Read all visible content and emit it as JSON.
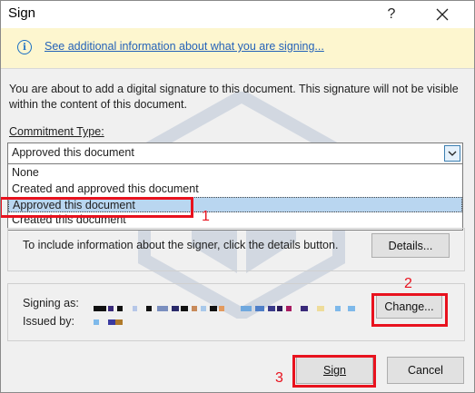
{
  "dialog": {
    "title": "Sign",
    "help_label": "?",
    "close_label": "✕"
  },
  "infobar": {
    "icon": "info-icon",
    "link_text": "See additional information about what you are signing..."
  },
  "description": "You are about to add a digital signature to this document. This signature will not be visible within the content of this document.",
  "commitment": {
    "label": "Commitment Type:",
    "selected": "Approved this document",
    "options": [
      "None",
      "Created and approved this document",
      "Approved this document",
      "Created this document"
    ]
  },
  "details": {
    "text": "To include information about the signer, click the details button.",
    "button_label": "Details..."
  },
  "signing": {
    "signing_as_label": "Signing as:",
    "issued_by_label": "Issued by:",
    "change_button_label": "Change..."
  },
  "footer": {
    "sign_label": "Sign",
    "cancel_label": "Cancel"
  },
  "annotations": [
    "1",
    "2",
    "3"
  ],
  "colors": {
    "annotation": "#e8121e",
    "link": "#2462b8",
    "infobar": "#fdf6cf",
    "selection": "#b9d6f0"
  }
}
